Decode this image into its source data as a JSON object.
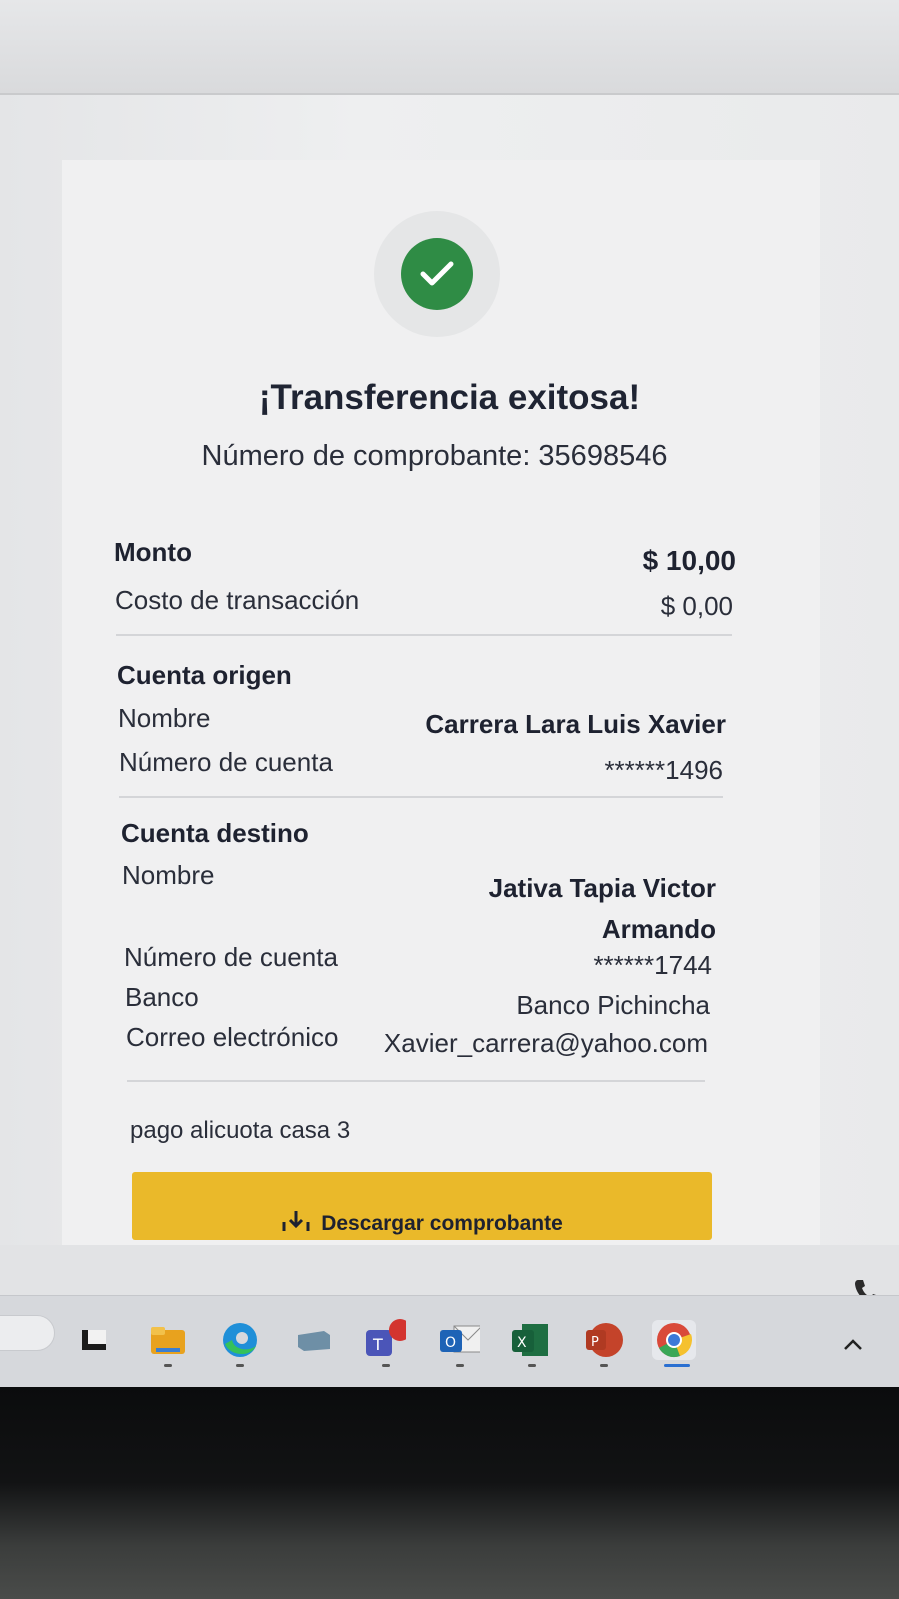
{
  "header": {
    "title": "¡Transferencia exitosa!",
    "receipt_label": "Número de comprobante: 35698546"
  },
  "amounts": {
    "monto_label": "Monto",
    "monto_value": "$ 10,00",
    "costo_label": "Costo de transacción",
    "costo_value": "$ 0,00"
  },
  "origin": {
    "section_title": "Cuenta origen",
    "name_label": "Nombre",
    "name_value": "Carrera Lara Luis Xavier",
    "account_label": "Número de cuenta",
    "account_value": "******1496"
  },
  "destination": {
    "section_title": "Cuenta destino",
    "name_label": "Nombre",
    "name_value_line1": "Jativa Tapia Victor",
    "name_value_line2": "Armando",
    "account_label": "Número de cuenta",
    "account_value": "******1744",
    "bank_label": "Banco",
    "bank_value": "Banco Pichincha",
    "email_label": "Correo electrónico",
    "email_value": "Xavier_carrera@yahoo.com"
  },
  "note": "pago alicuota casa 3",
  "download_button": {
    "label": "Descargar comprobante",
    "icon": "download-icon"
  },
  "colors": {
    "success": "#2f8c45",
    "button": "#eab92a",
    "text": "#1e2230"
  },
  "taskbar": {
    "icons": [
      "task-view-icon",
      "file-explorer-icon",
      "edge-icon",
      "app-icon",
      "teams-icon",
      "outlook-icon",
      "excel-icon",
      "powerpoint-icon",
      "chrome-icon"
    ]
  }
}
